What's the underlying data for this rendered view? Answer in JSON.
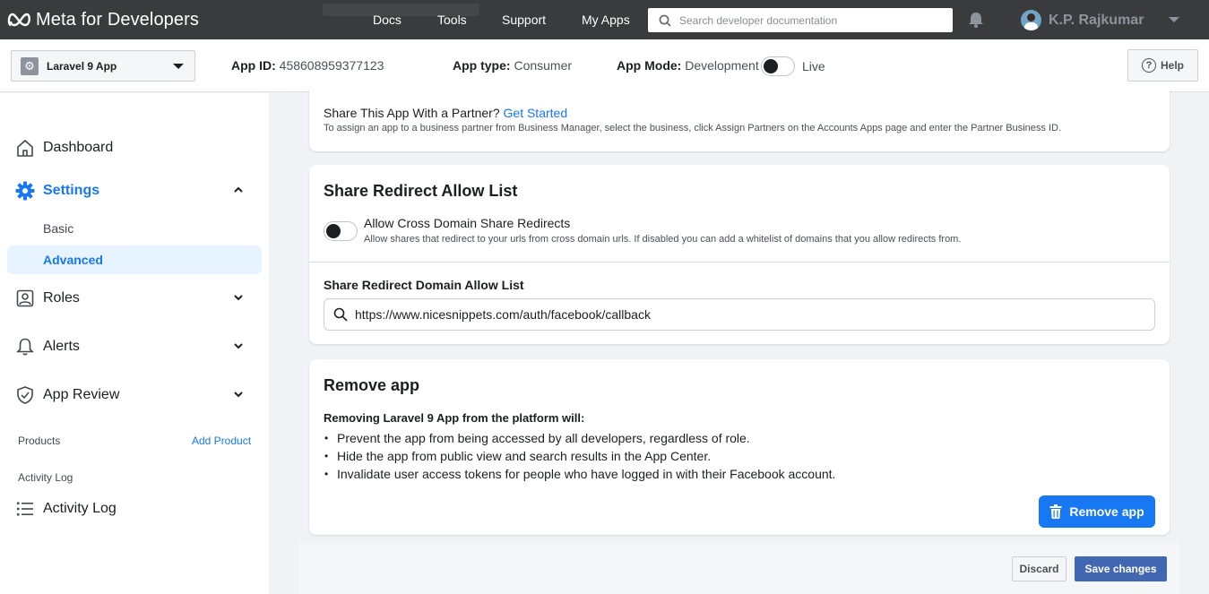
{
  "topbar": {
    "brand": "Meta for Developers",
    "nav": [
      "Docs",
      "Tools",
      "Support",
      "My Apps"
    ],
    "search_placeholder": "Search developer documentation",
    "user_name": "K.P. Rajkumar"
  },
  "appbar": {
    "app_name": "Laravel 9 App",
    "app_id_label": "App ID:",
    "app_id": "458608959377123",
    "app_type_label": "App type:",
    "app_type": "Consumer",
    "app_mode_label": "App Mode:",
    "app_mode": "Development",
    "live_label": "Live",
    "help_label": "Help"
  },
  "sidebar": {
    "dashboard": "Dashboard",
    "settings": "Settings",
    "basic": "Basic",
    "advanced": "Advanced",
    "roles": "Roles",
    "alerts": "Alerts",
    "app_review": "App Review",
    "products_label": "Products",
    "add_product": "Add Product",
    "activity_log_label": "Activity Log",
    "activity_log": "Activity Log"
  },
  "partner": {
    "text": "Share This App With a Partner?",
    "link": "Get Started",
    "description": "To assign an app to a business partner from Business Manager, select the business, click Assign Partners on the Accounts Apps page and enter the Partner Business ID."
  },
  "share_redirect": {
    "title": "Share Redirect Allow List",
    "option_title": "Allow Cross Domain Share Redirects",
    "option_desc": "Allow shares that redirect to your urls from cross domain urls. If disabled you can add a whitelist of domains that you allow redirects from.",
    "field_label": "Share Redirect Domain Allow List",
    "field_value": "https://www.nicesnippets.com/auth/facebook/callback"
  },
  "remove_app": {
    "title": "Remove app",
    "intro": "Removing Laravel 9 App from the platform will:",
    "bullets": [
      "Prevent the app from being accessed by all developers, regardless of role.",
      "Hide the app from public view and search results in the App Center.",
      "Invalidate user access tokens for people who have logged in with their Facebook account."
    ],
    "button": "Remove app"
  },
  "footer": {
    "discard": "Discard",
    "save": "Save changes"
  },
  "colors": {
    "accent": "#1877f2",
    "topbar": "#3a3b3c",
    "save_button": "#4267b2"
  }
}
